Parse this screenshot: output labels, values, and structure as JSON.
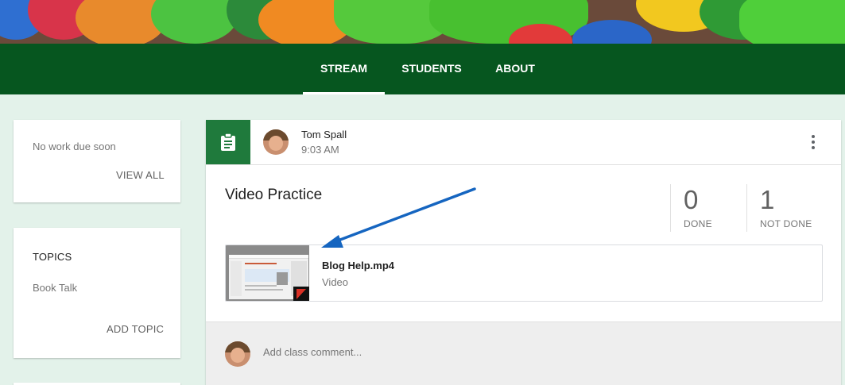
{
  "nav": {
    "tabs": [
      {
        "label": "STREAM",
        "active": true
      },
      {
        "label": "STUDENTS",
        "active": false
      },
      {
        "label": "ABOUT",
        "active": false
      }
    ]
  },
  "upcoming": {
    "status": "No work due soon",
    "view_all": "VIEW ALL"
  },
  "topics": {
    "heading": "TOPICS",
    "items": [
      "Book Talk"
    ],
    "add_topic": "ADD TOPIC"
  },
  "post": {
    "author": "Tom Spall",
    "time": "9:03 AM",
    "icon": "assignment-icon",
    "title": "Video Practice",
    "stats": [
      {
        "count": "0",
        "label": "DONE"
      },
      {
        "count": "1",
        "label": "NOT DONE"
      }
    ],
    "attachment": {
      "name": "Blog Help.mp4",
      "type": "Video"
    },
    "comment_placeholder": "Add class comment..."
  },
  "colors": {
    "nav_bg": "#06561f",
    "post_icon_bg": "#1f7a3c",
    "page_bg": "#e3f2ea",
    "annotation_arrow": "#1565c0"
  }
}
